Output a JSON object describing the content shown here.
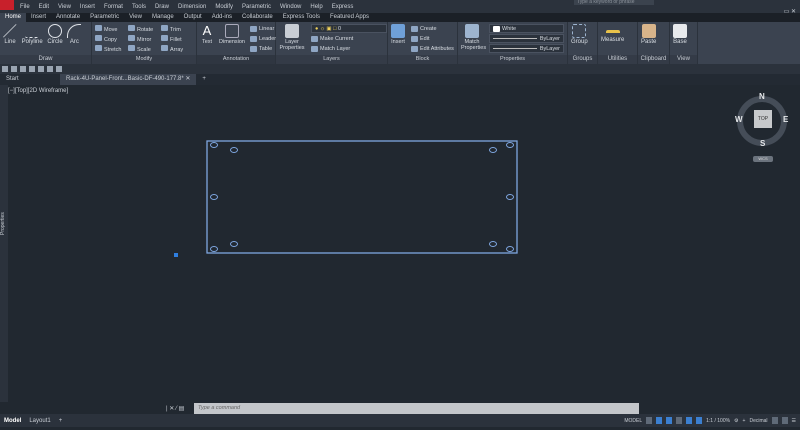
{
  "menu": [
    "File",
    "Edit",
    "View",
    "Insert",
    "Format",
    "Tools",
    "Draw",
    "Dimension",
    "Modify",
    "Parametric",
    "Window",
    "Help",
    "Express"
  ],
  "search_placeholder": "Type a keyword or phrase",
  "ribbon_tabs": [
    "Home",
    "Insert",
    "Annotate",
    "Parametric",
    "View",
    "Manage",
    "Output",
    "Add-ins",
    "Collaborate",
    "Express Tools",
    "Featured Apps"
  ],
  "panels": {
    "draw": {
      "title": "Draw",
      "tools": [
        "Line",
        "Polyline",
        "Circle",
        "Arc"
      ]
    },
    "modify": {
      "title": "Modify",
      "items": [
        "Move",
        "Rotate",
        "Trim",
        "Copy",
        "Mirror",
        "Fillet",
        "Stretch",
        "Scale",
        "Array"
      ]
    },
    "annotation": {
      "title": "Annotation",
      "tools": [
        "Text",
        "Dimension"
      ],
      "items": [
        "Linear",
        "Leader",
        "Table"
      ]
    },
    "layers": {
      "title": "Layers",
      "tool": "Layer Properties",
      "layer": "0",
      "items": [
        "Make Current",
        "Match Layer"
      ]
    },
    "block": {
      "title": "Block",
      "tool": "Insert",
      "items": [
        "Create",
        "Edit",
        "Edit Attributes"
      ]
    },
    "properties": {
      "title": "Properties",
      "tool": "Match Properties",
      "color": "White",
      "linetype": "ByLayer",
      "lineweight": "ByLayer"
    },
    "groups": {
      "title": "Groups",
      "tool": "Group"
    },
    "utilities": {
      "title": "Utilities",
      "tool": "Measure"
    },
    "clipboard": {
      "title": "Clipboard",
      "tool": "Paste"
    },
    "view": {
      "title": "View",
      "tool": "Base"
    }
  },
  "doc_tabs": [
    "Start",
    "Rack-4U-Panel-Front...Basic-DF-490-177.8*"
  ],
  "viewport_label": "[−][Top][2D Wireframe]",
  "palette_label": "Properties",
  "viewcube": {
    "face": "TOP",
    "n": "N",
    "s": "S",
    "e": "E",
    "w": "W",
    "wcs": "WCS"
  },
  "command_placeholder": "Type a command",
  "layout_tabs": [
    "Model",
    "Layout1"
  ],
  "status": {
    "mode": "MODEL",
    "scale": "1:1 / 100%",
    "units": "Decimal"
  },
  "colors": {
    "geometry": "#7ea6e0",
    "background": "#212830"
  }
}
